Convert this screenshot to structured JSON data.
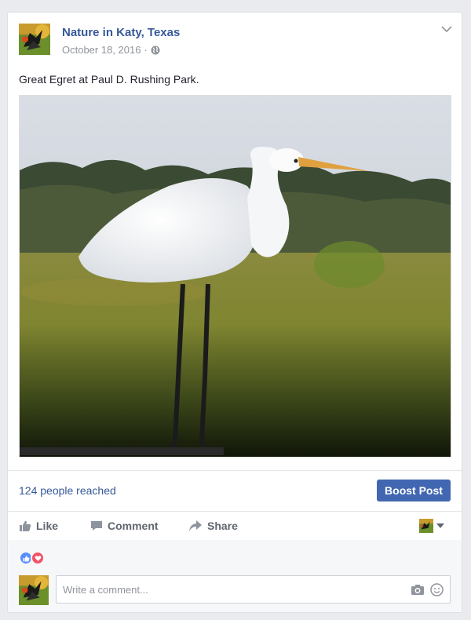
{
  "post": {
    "page_name": "Nature in Katy, Texas",
    "date": "October 18, 2016",
    "separator": "·",
    "caption": "Great Egret at Paul D. Rushing Park.",
    "photo_icon": "egret-photo"
  },
  "insights": {
    "reach": "124 people reached",
    "boost_label": "Boost Post"
  },
  "actions": {
    "like": "Like",
    "comment": "Comment",
    "share": "Share"
  },
  "comment_box": {
    "placeholder": "Write a comment..."
  },
  "colors": {
    "link_blue": "#365899",
    "boost_blue": "#4267b2",
    "like_blue": "#598eff",
    "love_red": "#f25268"
  }
}
